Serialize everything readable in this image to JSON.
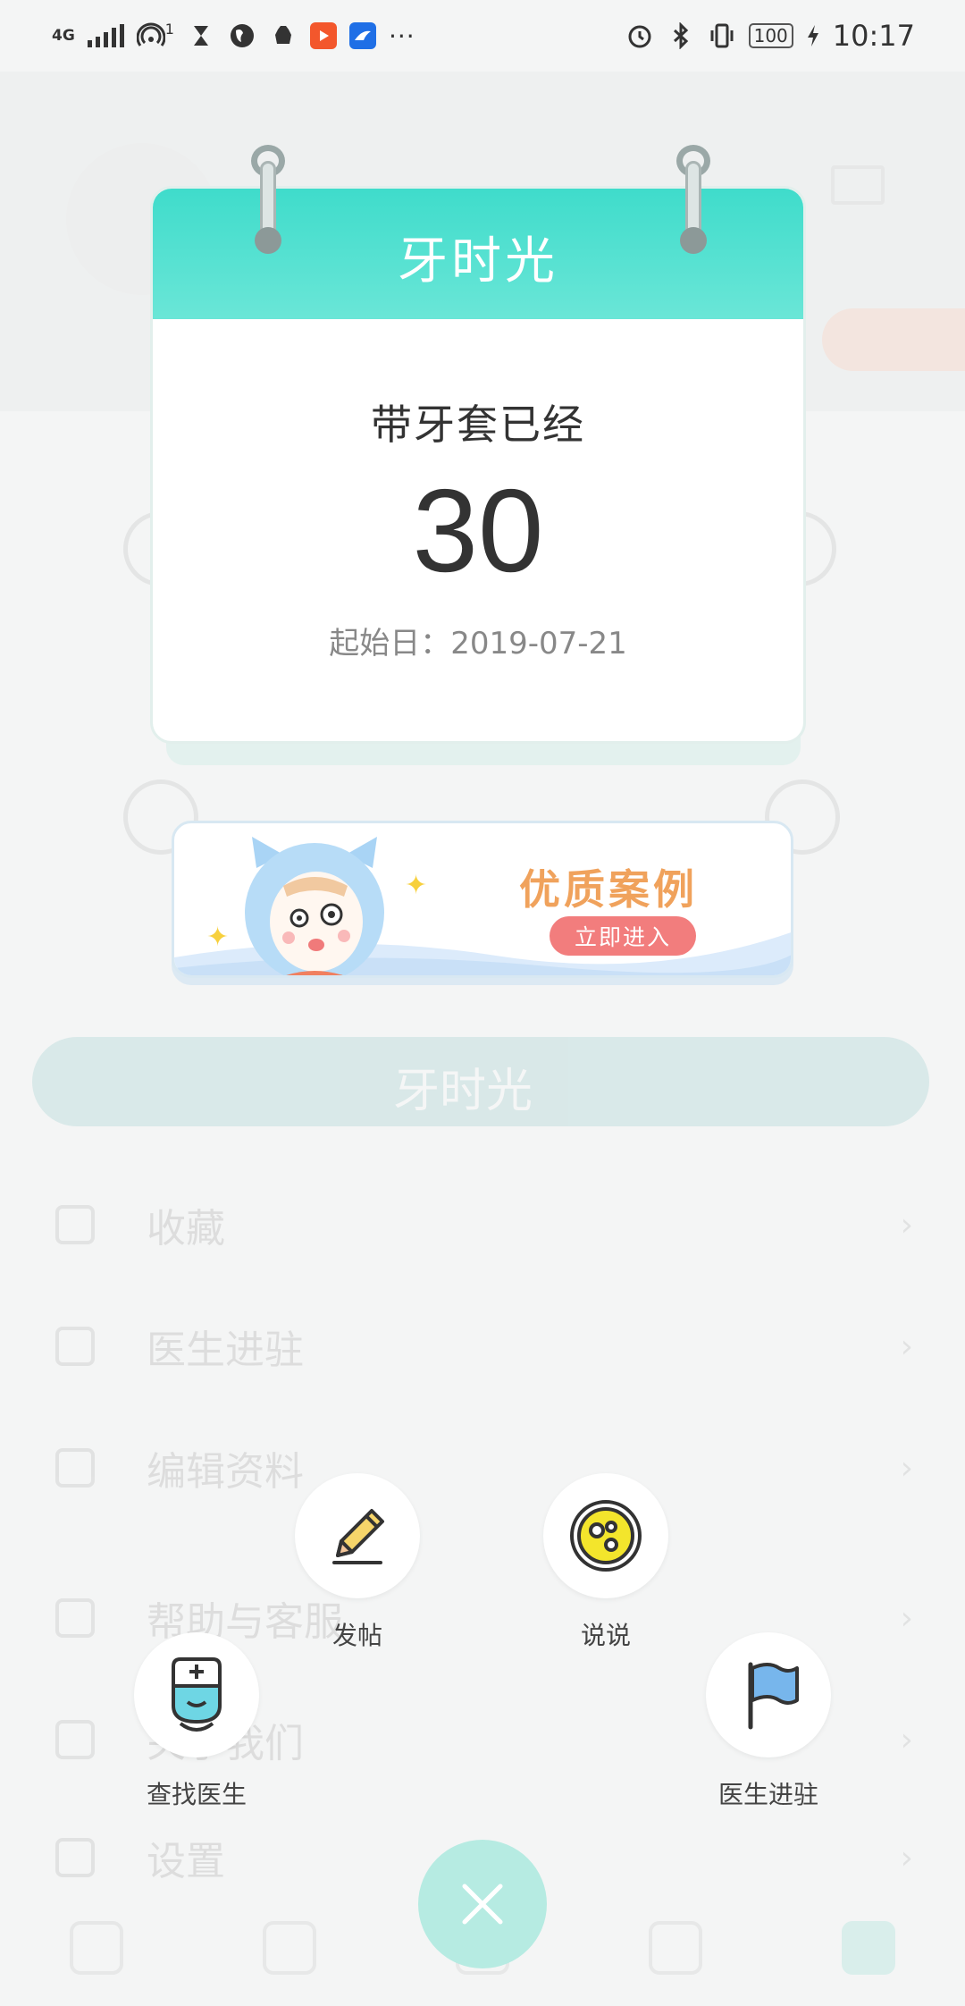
{
  "status_bar": {
    "network": "4G",
    "hotspot_count": "1",
    "battery": "100",
    "time": "10:17"
  },
  "background": {
    "banner_text": "牙时光",
    "menu": [
      "收藏",
      "医生进驻",
      "编辑资料",
      "帮助与客服",
      "关于我们",
      "设置"
    ]
  },
  "calendar": {
    "title": "牙时光",
    "label": "带牙套已经",
    "days": "30",
    "start_label": "起始日：",
    "start_date": "2019-07-21"
  },
  "promo": {
    "title": "优质案例",
    "cta": "立即进入"
  },
  "actions": {
    "post": "发帖",
    "talk": "说说",
    "find_doctor": "查找医生",
    "doctor_join": "医生进驻"
  },
  "colors": {
    "accent": "#3fdccb",
    "promo_title": "#f0a25c",
    "promo_cta": "#f27d7d",
    "close_button": "#b6ebe2"
  }
}
